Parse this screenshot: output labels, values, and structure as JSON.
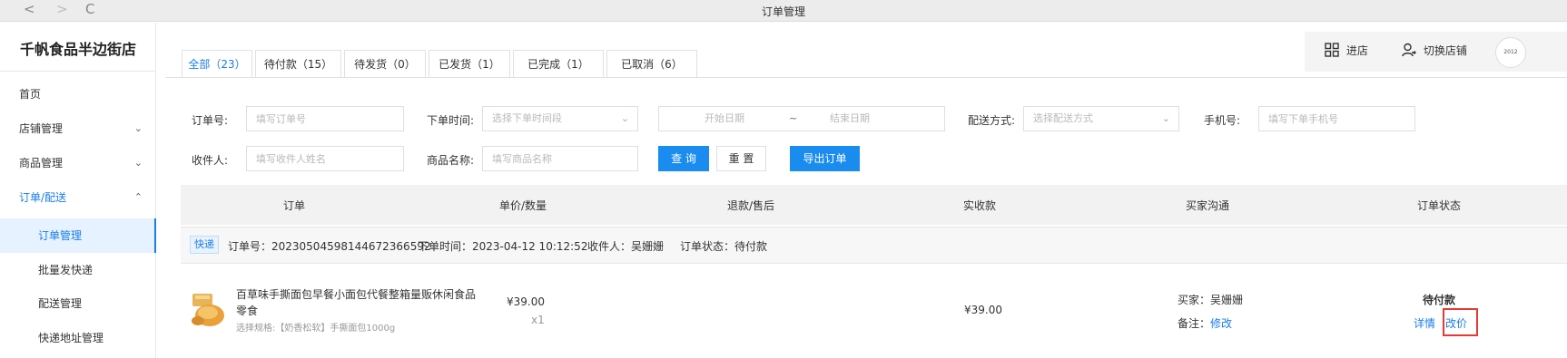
{
  "window": {
    "title": "订单管理",
    "back": "<",
    "forward": ">",
    "refresh": "C"
  },
  "sidebar": {
    "shop_name": "千帆食品半边街店",
    "items": [
      {
        "label": "首页"
      },
      {
        "label": "店铺管理",
        "chevron": "⌄"
      },
      {
        "label": "商品管理",
        "chevron": "⌄"
      },
      {
        "label": "订单/配送",
        "chevron": "⌃"
      }
    ],
    "subitems": [
      {
        "label": "订单管理"
      },
      {
        "label": "批量发快递"
      },
      {
        "label": "配送管理"
      },
      {
        "label": "快递地址管理"
      }
    ]
  },
  "topright": {
    "enter_label": "进店",
    "switch_label": "切换店铺",
    "avatar_text": "2012"
  },
  "tabs": [
    {
      "label": "全部（23）"
    },
    {
      "label": "待付款（15）"
    },
    {
      "label": "待发货（0）"
    },
    {
      "label": "已发货（1）"
    },
    {
      "label": "已完成（1）"
    },
    {
      "label": "已取消（6）"
    }
  ],
  "filters": {
    "order_no_label": "订单号:",
    "order_no_placeholder": "填写订单号",
    "time_label": "下单时间:",
    "time_placeholder": "选择下单时间段",
    "start_placeholder": "开始日期",
    "tilde": "~",
    "end_placeholder": "结束日期",
    "delivery_label": "配送方式:",
    "delivery_placeholder": "选择配送方式",
    "phone_label": "手机号:",
    "phone_placeholder": "填写下单手机号",
    "receiver_label": "收件人:",
    "receiver_placeholder": "填写收件人姓名",
    "product_label": "商品名称:",
    "product_placeholder": "填写商品名称",
    "query_button": "查 询",
    "reset_button": "重 置",
    "export_button": "导出订单"
  },
  "table": {
    "headers": [
      "订单",
      "单价/数量",
      "退款/售后",
      "实收款",
      "买家沟通",
      "订单状态"
    ],
    "order": {
      "badge": "快递",
      "order_no": "订单号：2023050459814467​2366592",
      "order_time": "下单时间：2023-04-12 10:12:52",
      "receiver": "收件人：吴姗姗",
      "status_info": "订单状态：待付款",
      "product_title": "百草味手撕面包早餐小面包代餐整箱量贩休闲食品零食",
      "product_spec": "选择规格:【奶香松软】手撕面包1000g",
      "price": "¥39.00",
      "qty": "x1",
      "received": "¥39.00",
      "buyer_label": "买家：吴姗姗",
      "remark_label": "备注：",
      "remark_link": "修改",
      "status": "待付款",
      "detail_link": "详情",
      "reprice_link": "改价"
    }
  }
}
